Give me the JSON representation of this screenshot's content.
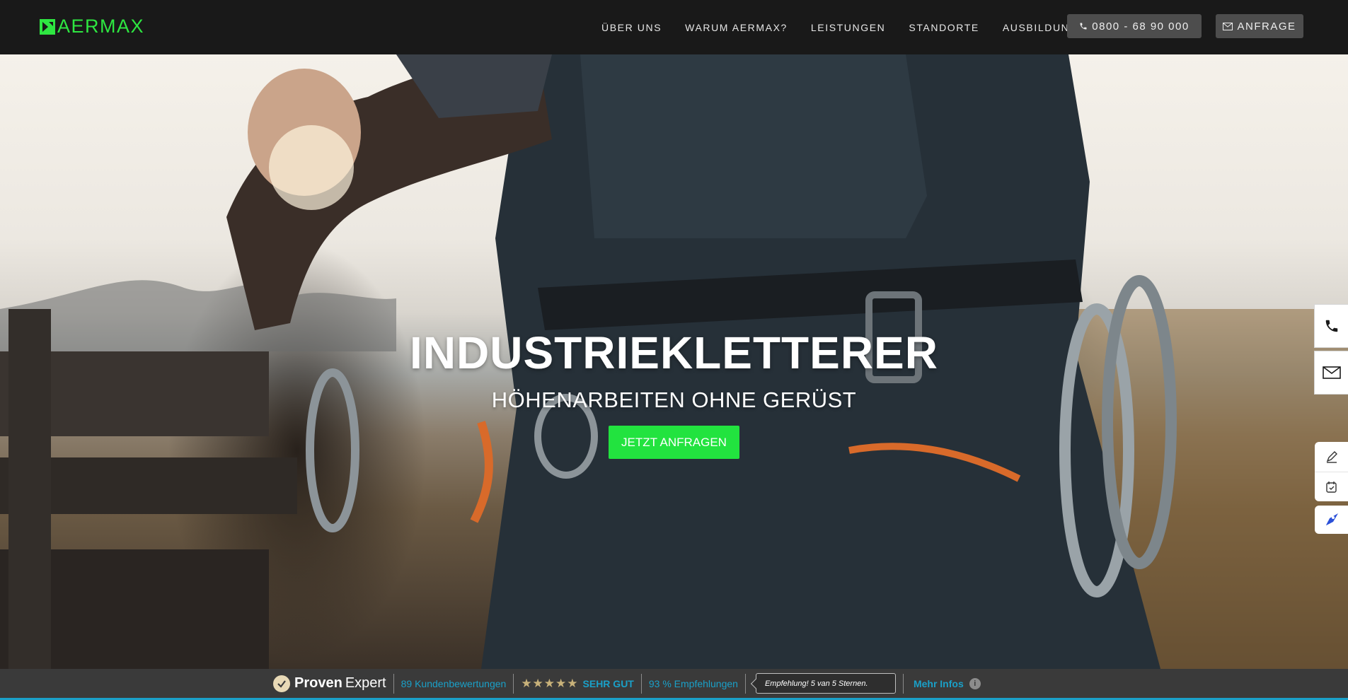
{
  "brand": {
    "name": "AERMAX",
    "color": "#2ee641"
  },
  "nav": {
    "links": [
      {
        "label": "ÜBER UNS"
      },
      {
        "label": "WARUM AERMAX?"
      },
      {
        "label": "LEISTUNGEN"
      },
      {
        "label": "STANDORTE"
      },
      {
        "label": "AUSBILDUNG"
      }
    ],
    "phone_label": "0800 - 68 90 000",
    "phone_icon": "phone-icon",
    "inquiry_label": "ANFRAGE",
    "inquiry_icon": "envelope-icon"
  },
  "hero": {
    "title": "INDUSTRIEKLETTERER",
    "subtitle": "HÖHENARBEITEN OHNE GERÜST",
    "cta_label": "JETZT ANFRAGEN",
    "cta_color": "#22e33f"
  },
  "side_widgets": {
    "contact": [
      "phone-icon",
      "envelope-icon"
    ],
    "tools": [
      "edit-icon",
      "checklist-icon",
      "rocket-icon"
    ]
  },
  "proven_expert": {
    "brand_bold": "Proven",
    "brand_light": "Expert",
    "reviews": "89 Kundenbewertungen",
    "stars": "★★★★★",
    "rating_text": "SEHR GUT",
    "recommendations": "93 % Empfehlungen",
    "quote": "Empfehlung! 5 van 5 Sternen.",
    "more_label": "Mehr Infos",
    "accent_color": "#1aa0c8"
  }
}
